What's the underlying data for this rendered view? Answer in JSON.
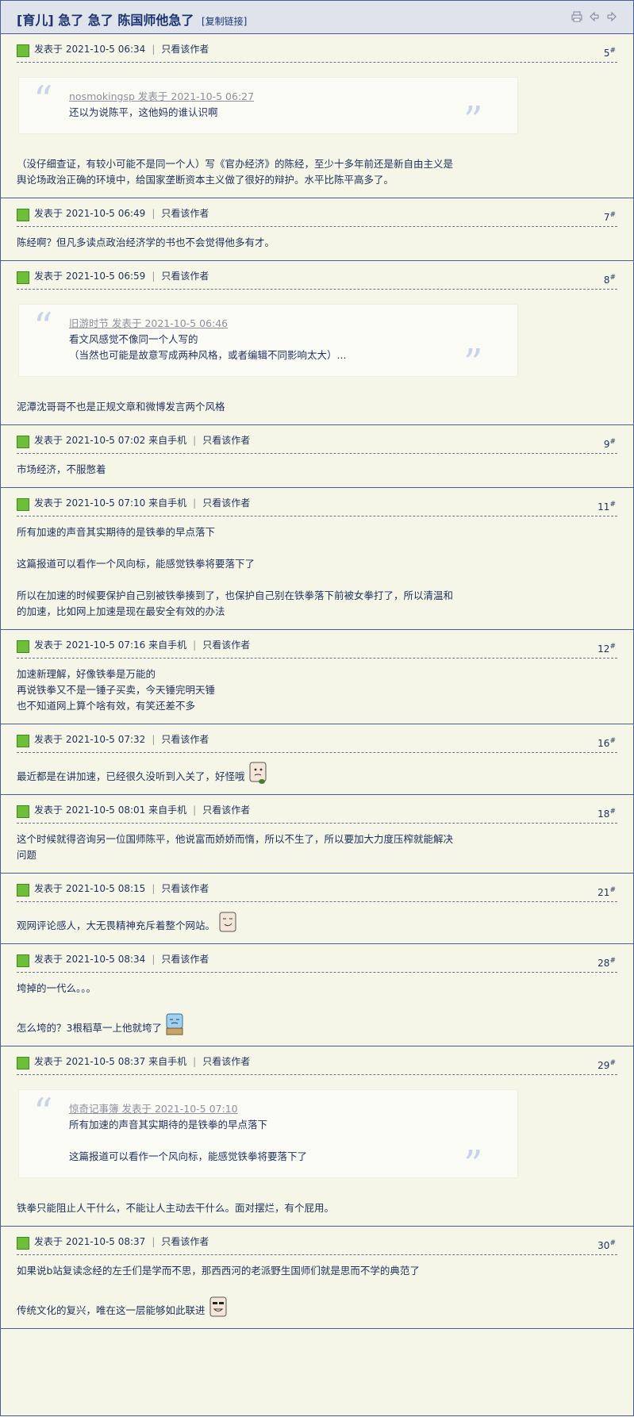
{
  "thread": {
    "tag": "[育儿]",
    "title": "急了 急了 陈国师他急了",
    "copy_link": "[复制链接]"
  },
  "posts": [
    {
      "meta": "发表于 2021-10-5 06:34",
      "author_link": "只看该作者",
      "num": "5",
      "quote_author": "nosmokingsp 发表于 2021-10-5 06:27",
      "quote_lines": [
        "还以为说陈平，这他妈的谁认识啊"
      ],
      "lines": [
        "（没仔细查证，有较小可能不是同一个人）写《官办经济》的陈经，至少十多年前还是新自由主义是",
        "舆论场政治正确的环境中，给国家垄断资本主义做了很好的辩护。水平比陈平高多了。"
      ]
    },
    {
      "meta": "发表于 2021-10-5 06:49",
      "author_link": "只看该作者",
      "num": "7",
      "lines": [
        "陈经啊？但凡多读点政治经济学的书也不会觉得他多有才。"
      ]
    },
    {
      "meta": "发表于 2021-10-5 06:59",
      "author_link": "只看该作者",
      "num": "8",
      "quote_author": "旧游时节 发表于 2021-10-5 06:46",
      "quote_lines": [
        "看文风感觉不像同一个人写的",
        "（当然也可能是故意写成两种风格，或者编辑不同影响太大）..."
      ],
      "lines": [
        "泥潭沈哥哥不也是正规文章和微博发言两个风格"
      ]
    },
    {
      "meta": "发表于 2021-10-5 07:02 来自手机",
      "author_link": "只看该作者",
      "num": "9",
      "lines": [
        "市场经济，不服憋着"
      ]
    },
    {
      "meta": "发表于 2021-10-5 07:10 来自手机",
      "author_link": "只看该作者",
      "num": "11",
      "lines": [
        "所有加速的声音其实期待的是铁拳的早点落下",
        "",
        "这篇报道可以看作一个风向标，能感觉铁拳将要落下了",
        "",
        "所以在加速的时候要保护自己别被铁拳揍到了，也保护自己别在铁拳落下前被女拳打了，所以清温和",
        "的加速，比如网上加速是现在最安全有效的办法"
      ]
    },
    {
      "meta": "发表于 2021-10-5 07:16 来自手机",
      "author_link": "只看该作者",
      "num": "12",
      "lines": [
        "加速新理解，好像铁拳是万能的",
        "再说铁拳又不是一锤子买卖，今天锤完明天锤",
        "也不知道网上算个啥有效，有笑还差不多"
      ]
    },
    {
      "meta": "发表于 2021-10-5 07:32",
      "author_link": "只看该作者",
      "num": "16",
      "lines": [
        "最近都是在讲加速，已经很久没听到入关了，好怪哦"
      ],
      "emoji": "wary-face-emoticon"
    },
    {
      "meta": "发表于 2021-10-5 08:01 来自手机",
      "author_link": "只看该作者",
      "num": "18",
      "lines": [
        "这个时候就得咨询另一位国师陈平，他说富而娇娇而惰，所以不生了，所以要加大力度压榨就能解决",
        "问题"
      ]
    },
    {
      "meta": "发表于 2021-10-5 08:15",
      "author_link": "只看该作者",
      "num": "21",
      "lines": [
        "观网评论感人，大无畏精神充斥着整个网站。"
      ],
      "emoji": "smirk-face-emoticon"
    },
    {
      "meta": "发表于 2021-10-5 08:34",
      "author_link": "只看该作者",
      "num": "28",
      "lines": [
        "垮掉的一代么。。。",
        "",
        "怎么垮的？3根稻草一上他就垮了"
      ],
      "emoji": "crying-box-emoticon"
    },
    {
      "meta": "发表于 2021-10-5 08:37 来自手机",
      "author_link": "只看该作者",
      "num": "29",
      "quote_author": "惊奇记事簿 发表于 2021-10-5 07:10",
      "quote_lines": [
        "所有加速的声音其实期待的是铁拳的早点落下",
        "",
        "这篇报道可以看作一个风向标，能感觉铁拳将要落下了"
      ],
      "lines": [
        "铁拳只能阻止人干什么，不能让人主动去干什么。面对摆烂，有个屁用。"
      ]
    },
    {
      "meta": "发表于 2021-10-5 08:37",
      "author_link": "只看该作者",
      "num": "30",
      "lines": [
        "如果说b站复读念经的左壬们是学而不思，那西西河的老派野生国师们就是思而不学的典范了",
        "",
        "传统文化的复兴，唯在这一层能够如此联进"
      ],
      "emoji": "grin-face-emoticon"
    }
  ]
}
